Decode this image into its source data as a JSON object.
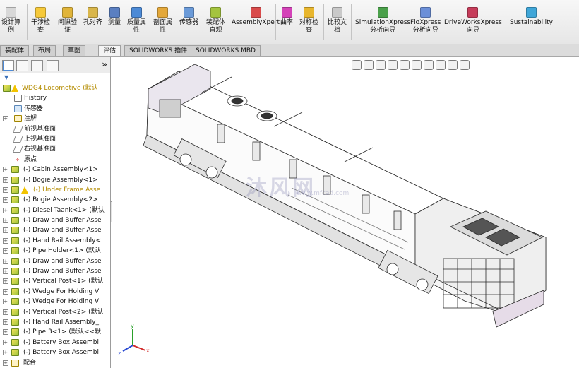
{
  "ribbon": {
    "buttons": [
      {
        "id": "design-study",
        "label": "设计算\n例",
        "icon": "design-study-icon",
        "color": "#d8d8d8"
      },
      {
        "id": "interference",
        "label": "干涉检\n查",
        "icon": "interference-check-icon",
        "color": "#f6c93a"
      },
      {
        "id": "clearance",
        "label": "间隙验\n证",
        "icon": "clearance-verify-icon",
        "color": "#e0b43a"
      },
      {
        "id": "hole-align",
        "label": "孔对齐",
        "icon": "hole-align-icon",
        "color": "#d9b64a"
      },
      {
        "id": "measure",
        "label": "测量",
        "icon": "measure-icon",
        "color": "#5a7fc1"
      },
      {
        "id": "mass-props",
        "label": "质量属\n性",
        "icon": "mass-properties-icon",
        "color": "#4c8ad6"
      },
      {
        "id": "section-props",
        "label": "剖面属\n性",
        "icon": "section-properties-icon",
        "color": "#e4a83a"
      },
      {
        "id": "sensor",
        "label": "传感器",
        "icon": "sensor-icon",
        "color": "#6a9ad8"
      },
      {
        "id": "assembly-viz",
        "label": "装配体\n直观",
        "icon": "assembly-visualization-icon",
        "color": "#a4c43e"
      },
      {
        "id": "assemblyxpert",
        "label": "AssemblyXpert",
        "icon": "assemblyxpert-icon",
        "color": "#d94a4a"
      },
      {
        "id": "curvature",
        "label": "曲率",
        "icon": "curvature-icon",
        "color": "#d442b8"
      },
      {
        "id": "symmetry",
        "label": "对称检\n查",
        "icon": "symmetry-check-icon",
        "color": "#e8b62e"
      },
      {
        "id": "compare",
        "label": "比较文\n档",
        "icon": "compare-documents-icon",
        "color": "#c9c9c9"
      },
      {
        "id": "simxpress",
        "label": "SimulationXpress\n分析向导",
        "icon": "simulationxpress-icon",
        "color": "#4aa04a"
      },
      {
        "id": "floxpress",
        "label": "FloXpress\n分析向导",
        "icon": "floxpress-icon",
        "color": "#6b8fd8"
      },
      {
        "id": "driveworks",
        "label": "DriveWorksXpress\n向导",
        "icon": "driveworksxpress-icon",
        "color": "#c63c5a"
      },
      {
        "id": "sustainability",
        "label": "Sustainability",
        "icon": "sustainability-icon",
        "color": "#3fa6d8"
      }
    ]
  },
  "tabs": [
    {
      "label": "装配体",
      "active": false
    },
    {
      "label": "布局",
      "active": false
    },
    {
      "label": "草图",
      "active": false
    },
    {
      "label": "评估",
      "active": true
    },
    {
      "label": "SOLIDWORKS 插件",
      "active": false
    },
    {
      "label": "SOLIDWORKS MBD",
      "active": false
    }
  ],
  "feature_manager": {
    "collapse_glyph": "»",
    "filter_glyph": "▼",
    "root": "WDG4 Locomotive  (默认",
    "items": [
      {
        "label": "History",
        "icon": "history-icon",
        "type": "hist",
        "exp": ""
      },
      {
        "label": "传感器",
        "icon": "sensors-icon",
        "type": "sens",
        "exp": ""
      },
      {
        "label": "注解",
        "icon": "annotations-icon",
        "type": "note",
        "exp": "+"
      },
      {
        "label": "前视基准面",
        "icon": "front-plane-icon",
        "type": "plane",
        "exp": ""
      },
      {
        "label": "上视基准面",
        "icon": "top-plane-icon",
        "type": "plane",
        "exp": ""
      },
      {
        "label": "右视基准面",
        "icon": "right-plane-icon",
        "type": "plane",
        "exp": ""
      },
      {
        "label": "原点",
        "icon": "origin-icon",
        "type": "orig",
        "exp": ""
      },
      {
        "label": "(-) Cabin Assembly<1>",
        "icon": "subassembly-icon",
        "type": "part",
        "exp": "+"
      },
      {
        "label": "(-) Bogie Assembly<1>",
        "icon": "subassembly-icon",
        "type": "part",
        "exp": "+"
      },
      {
        "label": "(-) Under Frame Asse",
        "icon": "subassembly-icon",
        "type": "part",
        "exp": "+",
        "warn": true
      },
      {
        "label": "(-) Bogie Assembly<2>",
        "icon": "subassembly-icon",
        "type": "part",
        "exp": "+"
      },
      {
        "label": "(-) Diesel Taank<1> (默认",
        "icon": "part-icon",
        "type": "part",
        "exp": "+"
      },
      {
        "label": "(-) Draw and Buffer Asse",
        "icon": "subassembly-icon",
        "type": "part",
        "exp": "+"
      },
      {
        "label": "(-) Draw and Buffer Asse",
        "icon": "subassembly-icon",
        "type": "part",
        "exp": "+"
      },
      {
        "label": "(-) Hand Rail Assembly<",
        "icon": "subassembly-icon",
        "type": "part",
        "exp": "+"
      },
      {
        "label": "(-) Pipe Holder<1> (默认",
        "icon": "part-icon",
        "type": "part",
        "exp": "+"
      },
      {
        "label": "(-) Draw and Buffer Asse",
        "icon": "subassembly-icon",
        "type": "part",
        "exp": "+"
      },
      {
        "label": "(-) Draw and Buffer Asse",
        "icon": "subassembly-icon",
        "type": "part",
        "exp": "+"
      },
      {
        "label": "(-) Vertical Post<1> (默认",
        "icon": "part-icon",
        "type": "part",
        "exp": "+"
      },
      {
        "label": "(-) Wedge For Holding V",
        "icon": "part-icon",
        "type": "part",
        "exp": "+"
      },
      {
        "label": "(-) Wedge For Holding V",
        "icon": "part-icon",
        "type": "part",
        "exp": "+"
      },
      {
        "label": "(-) Vertical Post<2> (默认",
        "icon": "part-icon",
        "type": "part",
        "exp": "+"
      },
      {
        "label": "(-) Hand Rail Assembly_",
        "icon": "subassembly-icon",
        "type": "part",
        "exp": "+"
      },
      {
        "label": "(-) Pipe 3<1> (默认<<默",
        "icon": "part-icon",
        "type": "part",
        "exp": "+"
      },
      {
        "label": "(-) Battery Box Assembl",
        "icon": "subassembly-icon",
        "type": "part",
        "exp": "+"
      },
      {
        "label": "(-) Battery Box Assembl",
        "icon": "subassembly-icon",
        "type": "part",
        "exp": "+"
      },
      {
        "label": "配合",
        "icon": "mates-icon",
        "type": "note",
        "exp": "+"
      }
    ]
  },
  "graphics": {
    "watermark": "沐风网",
    "watermark_url": "www.mfcad.com",
    "triad_axes": [
      "x",
      "y",
      "z"
    ]
  }
}
